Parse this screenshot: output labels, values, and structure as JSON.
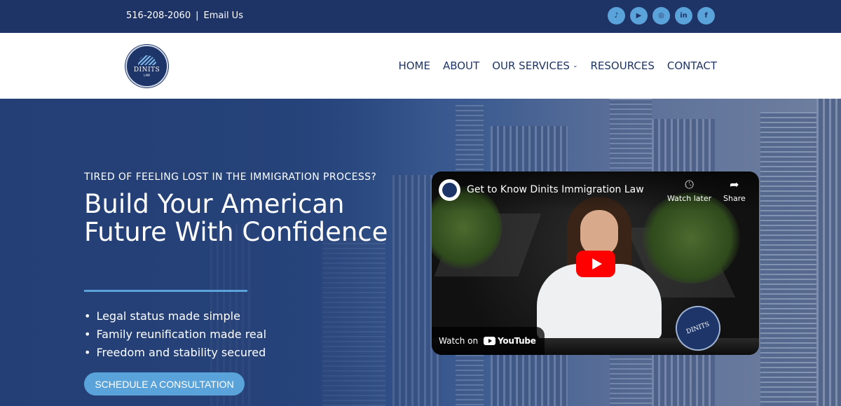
{
  "topbar": {
    "phone": "516-208-2060",
    "separator": "|",
    "email_label": "Email Us",
    "socials": [
      {
        "name": "tiktok",
        "glyph": "♪"
      },
      {
        "name": "youtube",
        "glyph": "▶"
      },
      {
        "name": "instagram",
        "glyph": "◎"
      },
      {
        "name": "linkedin",
        "glyph": "in"
      },
      {
        "name": "facebook",
        "glyph": "f"
      }
    ]
  },
  "nav": {
    "logo_text": "DINITS",
    "logo_sub": "LAW",
    "items": [
      "HOME",
      "ABOUT",
      "OUR SERVICES",
      "RESOURCES",
      "CONTACT"
    ],
    "services_chevron": "⌄"
  },
  "hero": {
    "kicker": "TIRED OF FEELING LOST IN THE IMMIGRATION PROCESS?",
    "headline": "Build Your American Future With Confidence",
    "bullets": [
      "Legal status made simple",
      "Family reunification made real",
      "Freedom and stability secured"
    ],
    "cta": "SCHEDULE A CONSULTATION"
  },
  "video": {
    "title": "Get to Know Dinits Immigration Law",
    "watch_later": "Watch later",
    "share": "Share",
    "watch_on": "Watch on",
    "youtube": "YouTube",
    "badge_text": "DINITS"
  },
  "colors": {
    "navy": "#1f3466",
    "accent": "#5aa3da",
    "white": "#ffffff",
    "play_red": "#ff0000"
  }
}
